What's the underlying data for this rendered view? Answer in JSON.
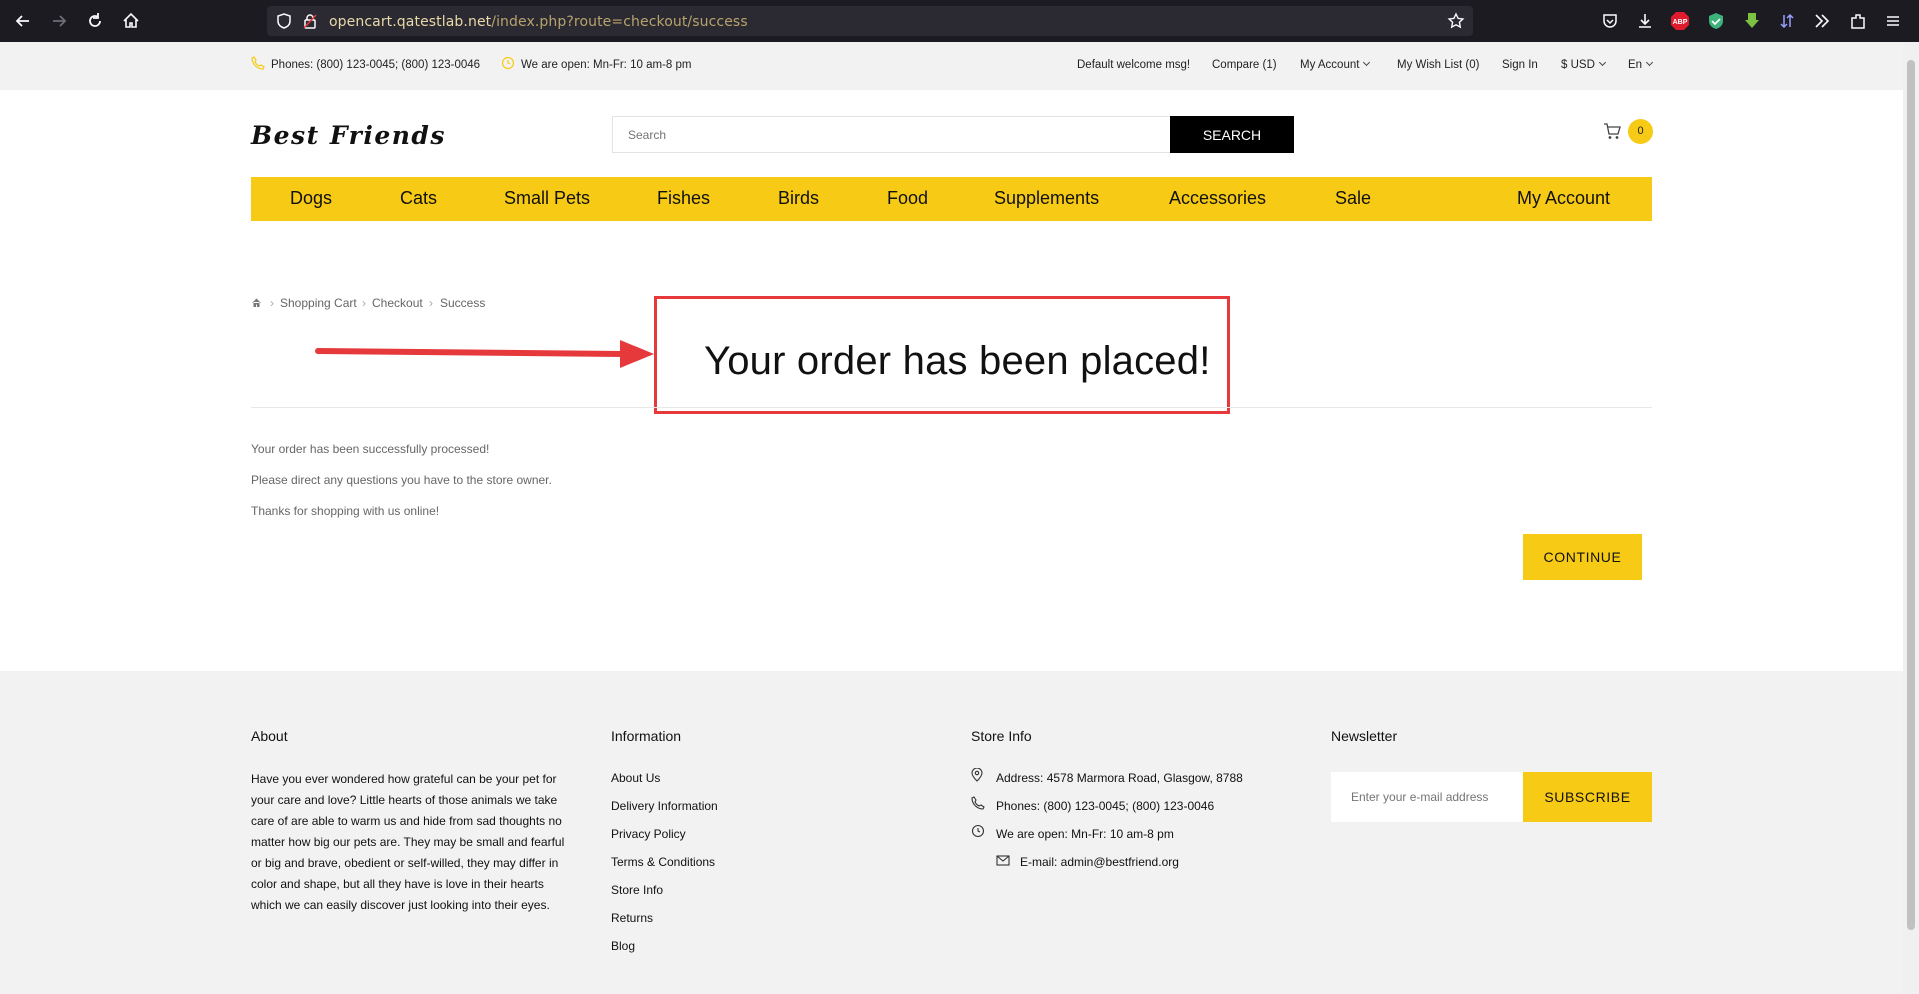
{
  "browser": {
    "url_host": "opencart.qatestlab.net",
    "url_path": "/index.php?route=checkout/success",
    "url_scheme_hidden": "opencart."
  },
  "topbar": {
    "phones": "Phones: (800) 123-0045; (800) 123-0046",
    "hours": "We are open: Mn-Fr: 10 am-8 pm",
    "welcome": "Default welcome msg!",
    "compare": "Compare (1)",
    "my_account": "My Account",
    "wishlist": "My Wish List (0)",
    "sign_in": "Sign In",
    "currency": "$ USD",
    "language": "En"
  },
  "header": {
    "logo": "Best Friends",
    "search_placeholder": "Search",
    "search_button": "SEARCH",
    "cart_count": "0"
  },
  "menu": {
    "items": [
      "Dogs",
      "Cats",
      "Small Pets",
      "Fishes",
      "Birds",
      "Food",
      "Supplements",
      "Accessories",
      "Sale",
      "My Account"
    ]
  },
  "breadcrumb": [
    "Shopping Cart",
    "Checkout",
    "Success"
  ],
  "main": {
    "heading": "Your order has been placed!",
    "messages": [
      "Your order has been successfully processed!",
      "Please direct any questions you have to the store owner.",
      "Thanks for shopping with us online!"
    ],
    "continue": "CONTINUE"
  },
  "footer": {
    "about_title": "About",
    "about_text": "Have you ever wondered how grateful can be your pet for your care and love? Little hearts of those animals we take care of are able to warm us and hide from sad thoughts no matter how big our pets are. They may be small and fearful or big and brave, obedient or self-willed, they may differ in color and shape, but all they have is love in their hearts which we can easily discover just looking into their eyes.",
    "info_title": "Information",
    "info_links": [
      "About Us",
      "Delivery Information",
      "Privacy Policy",
      "Terms & Conditions",
      "Store Info",
      "Returns",
      "Blog"
    ],
    "store_title": "Store Info",
    "address": "Address: 4578 Marmora Road, Glasgow, 8788",
    "phones": "Phones: (800) 123-0045; (800) 123-0046",
    "hours": "We are open: Mn-Fr: 10 am-8 pm",
    "email": "E-mail: admin@bestfriend.org",
    "newsletter_title": "Newsletter",
    "newsletter_placeholder": "Enter your e-mail address",
    "subscribe": "SUBSCRIBE"
  },
  "colors": {
    "accent": "#f7cb15",
    "annotation": "#e5393b",
    "browser_bg": "#1c1b22"
  }
}
